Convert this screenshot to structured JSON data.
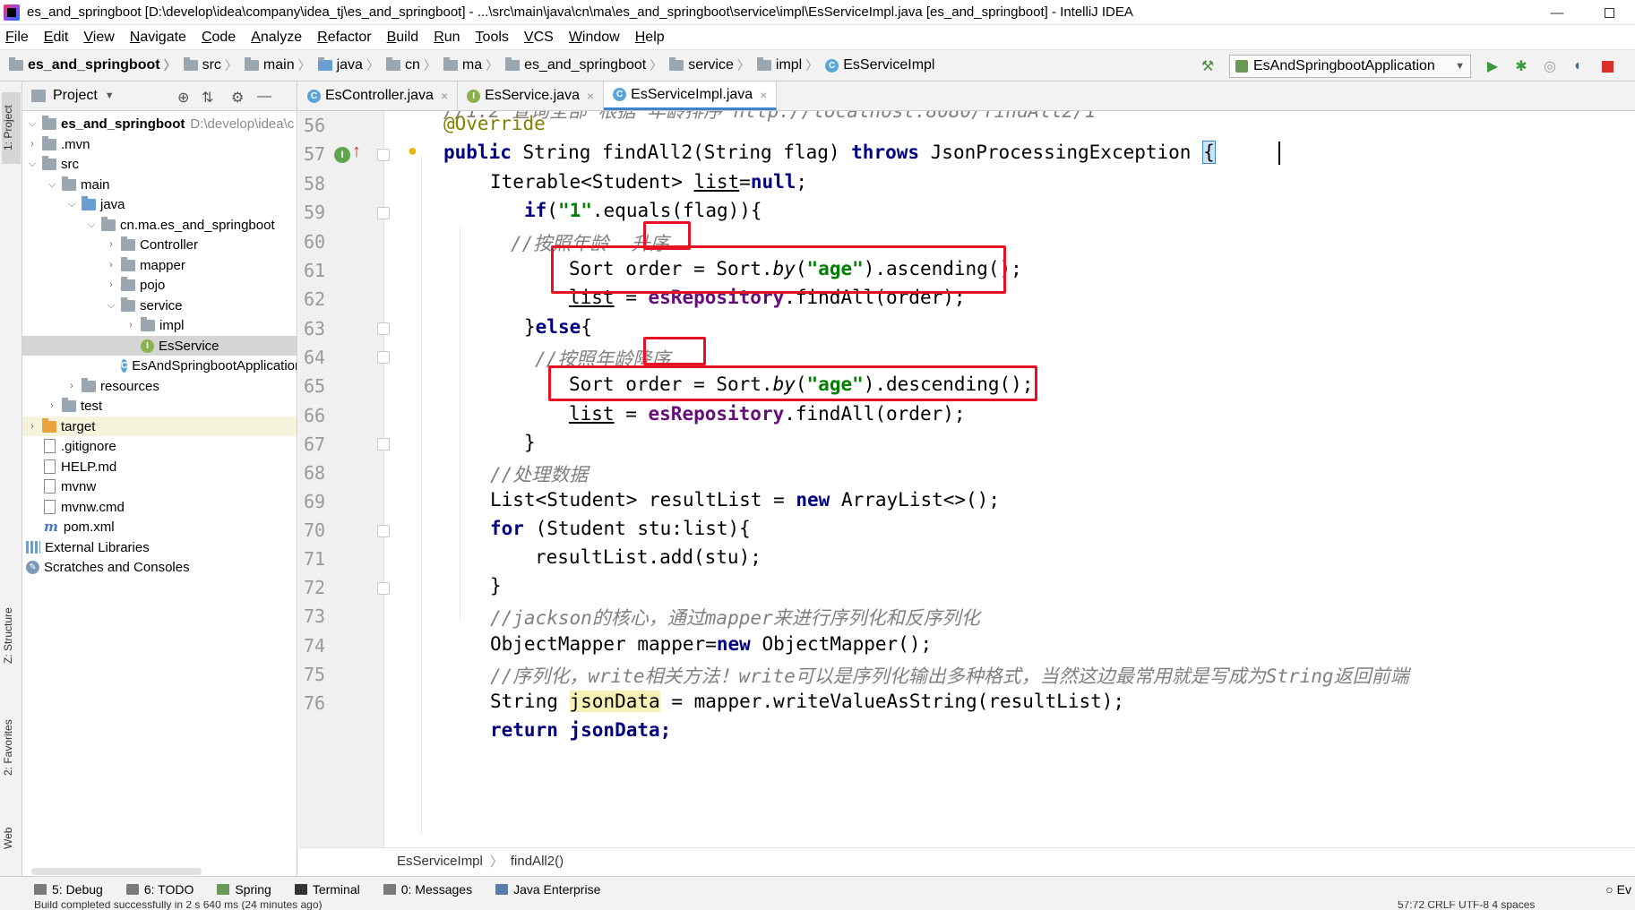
{
  "window": {
    "title": "es_and_springboot [D:\\develop\\idea\\company\\idea_tj\\es_and_springboot] - ...\\src\\main\\java\\cn\\ma\\es_and_springboot\\service\\impl\\EsServiceImpl.java [es_and_springboot] - IntelliJ IDEA",
    "minimize": "—"
  },
  "menu": [
    "File",
    "Edit",
    "View",
    "Navigate",
    "Code",
    "Analyze",
    "Refactor",
    "Build",
    "Run",
    "Tools",
    "VCS",
    "Window",
    "Help"
  ],
  "navbar": {
    "crumbs": [
      "es_and_springboot",
      "src",
      "main",
      "java",
      "cn",
      "ma",
      "es_and_springboot",
      "service",
      "impl",
      "EsServiceImpl"
    ],
    "run_config": "EsAndSpringbootApplication"
  },
  "left_strip": {
    "project": "1: Project",
    "structure": "Z: Structure",
    "favorites": "2: Favorites",
    "web": "Web"
  },
  "project_panel": {
    "title": "Project",
    "root_path": "D:\\develop\\idea\\c",
    "tree": [
      {
        "label": "es_and_springboot",
        "depth": 0,
        "kind": "root"
      },
      {
        "label": ".mvn",
        "depth": 1,
        "kind": "folder"
      },
      {
        "label": "src",
        "depth": 1,
        "kind": "folder"
      },
      {
        "label": "main",
        "depth": 2,
        "kind": "folder"
      },
      {
        "label": "java",
        "depth": 3,
        "kind": "folder-blue"
      },
      {
        "label": "cn.ma.es_and_springboot",
        "depth": 4,
        "kind": "package"
      },
      {
        "label": "Controller",
        "depth": 5,
        "kind": "package"
      },
      {
        "label": "mapper",
        "depth": 5,
        "kind": "package"
      },
      {
        "label": "pojo",
        "depth": 5,
        "kind": "package"
      },
      {
        "label": "service",
        "depth": 5,
        "kind": "package"
      },
      {
        "label": "impl",
        "depth": 6,
        "kind": "package"
      },
      {
        "label": "EsService",
        "depth": 6,
        "kind": "interface"
      },
      {
        "label": "EsAndSpringbootApplication",
        "depth": 5,
        "kind": "class"
      },
      {
        "label": "resources",
        "depth": 3,
        "kind": "folder"
      },
      {
        "label": "test",
        "depth": 2,
        "kind": "folder"
      },
      {
        "label": "target",
        "depth": 1,
        "kind": "folder-orange"
      },
      {
        "label": ".gitignore",
        "depth": 1,
        "kind": "file"
      },
      {
        "label": "HELP.md",
        "depth": 1,
        "kind": "file"
      },
      {
        "label": "mvnw",
        "depth": 1,
        "kind": "file"
      },
      {
        "label": "mvnw.cmd",
        "depth": 1,
        "kind": "file"
      },
      {
        "label": "pom.xml",
        "depth": 1,
        "kind": "maven"
      },
      {
        "label": "External Libraries",
        "depth": 0,
        "kind": "lib"
      },
      {
        "label": "Scratches and Consoles",
        "depth": 0,
        "kind": "scratch"
      }
    ]
  },
  "tabs": [
    {
      "label": "EsController.java",
      "icon": "class"
    },
    {
      "label": "EsService.java",
      "icon": "interface"
    },
    {
      "label": "EsServiceImpl.java",
      "icon": "class",
      "active": true
    }
  ],
  "editor": {
    "line_numbers": [
      "56",
      "57",
      "58",
      "59",
      "60",
      "61",
      "62",
      "63",
      "64",
      "65",
      "66",
      "67",
      "68",
      "69",
      "70",
      "71",
      "72",
      "73",
      "74",
      "75",
      "76"
    ],
    "top_partial": "//1.2 查询全部 根据 年龄排序 http://localhost:8080/findAll2/1",
    "l56_annotation": "@Override",
    "l57": {
      "kw1": "public",
      "t1": " String findAll2(String flag) ",
      "kw2": "throws",
      "t2": " JsonProcessingException ",
      "brace": "{"
    },
    "l58": {
      "t1": "Iterable<Student> ",
      "var": "list",
      "t2": "=",
      "kw": "null",
      "t3": ";"
    },
    "l59": {
      "kw": "if",
      "t1": "(",
      "str": "\"1\"",
      "t2": ".equals(flag)){"
    },
    "l60": {
      "c1": "//按照年龄  ",
      "c2": "升序"
    },
    "l61": {
      "t1": "Sort order = Sort.",
      "m": "by",
      "t2": "(",
      "str": "\"age\"",
      "t3": ").ascending();"
    },
    "l62": {
      "var": "list",
      "t1": " = ",
      "fld": "esRepository",
      "t2": ".findAll(order);"
    },
    "l63": {
      "t1": "}",
      "kw": "else",
      "t2": "{"
    },
    "l64": {
      "c1": "//按照年龄",
      "c2": "降序"
    },
    "l65": {
      "t1": "Sort order = Sort.",
      "m": "by",
      "t2": "(",
      "str": "\"age\"",
      "t3": ").descending();"
    },
    "l66": {
      "var": "list",
      "t1": " = ",
      "fld": "esRepository",
      "t2": ".findAll(order);"
    },
    "l67": "}",
    "l68": "//处理数据",
    "l69": {
      "t1": "List<Student> resultList = ",
      "kw": "new",
      "t2": " ArrayList<>();"
    },
    "l70": {
      "kw": "for",
      "t1": " (Student stu:list){"
    },
    "l71": "resultList.add(stu);",
    "l72": "}",
    "l73": "//jackson的核心，通过mapper来进行序列化和反序列化",
    "l74": {
      "t1": "ObjectMapper mapper=",
      "kw": "new",
      "t2": " ObjectMapper();"
    },
    "l75": "//序列化，write相关方法！write可以是序列化输出多种格式，当然这边最常用就是写成为String返回前端",
    "l76": {
      "t1": "String ",
      "var": "jsonData",
      "t2": " = mapper.writeValueAsString(resultList);"
    },
    "l77_partial": "return jsonData;"
  },
  "breadcrumb": {
    "cls": "EsServiceImpl",
    "method": "findAll2()"
  },
  "bottom_tools": [
    "5: Debug",
    "6: TODO",
    "Spring",
    "Terminal",
    "0: Messages",
    "Java Enterprise"
  ],
  "bottom_right": "Ev",
  "status": {
    "left": "Build completed successfully in 2 s 640 ms (24 minutes ago)",
    "right": "57:72   CRLF   UTF-8   4 spaces"
  }
}
